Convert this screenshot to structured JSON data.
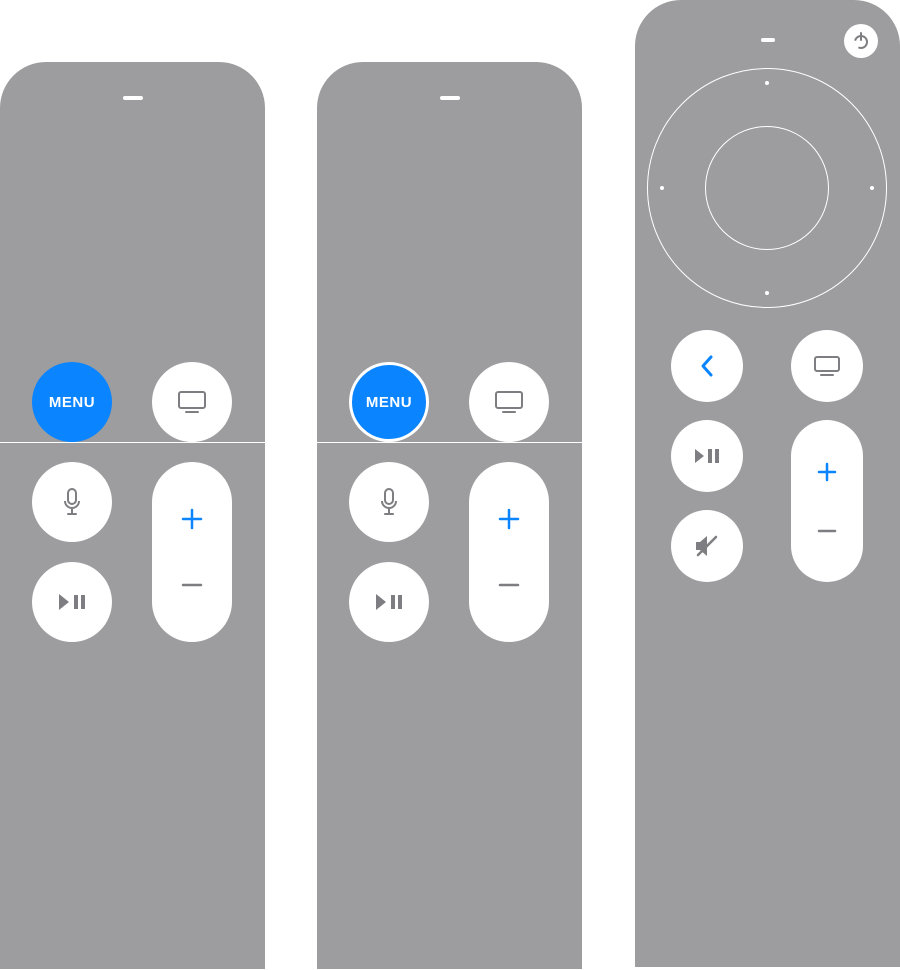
{
  "colors": {
    "remote_body": "#9d9da0",
    "button_bg": "#ffffff",
    "accent_blue": "#0a84ff",
    "icon_gray": "#7e7e82"
  },
  "remotes": [
    {
      "id": "siri-remote-1st-gen",
      "has_touch_surface": true,
      "buttons": {
        "menu": {
          "label": "MENU",
          "highlighted": true,
          "ring": false
        },
        "tv": {
          "icon": "tv-icon"
        },
        "mic": {
          "icon": "mic-icon"
        },
        "play_pause": {
          "icon": "play-pause-icon"
        },
        "volume": {
          "up_icon": "plus-icon",
          "down_icon": "minus-icon"
        }
      }
    },
    {
      "id": "siri-remote-1st-gen-alt",
      "has_touch_surface": true,
      "buttons": {
        "menu": {
          "label": "MENU",
          "highlighted": true,
          "ring": true
        },
        "tv": {
          "icon": "tv-icon"
        },
        "mic": {
          "icon": "mic-icon"
        },
        "play_pause": {
          "icon": "play-pause-icon"
        },
        "volume": {
          "up_icon": "plus-icon",
          "down_icon": "minus-icon"
        }
      }
    },
    {
      "id": "siri-remote-2nd-gen",
      "has_click_wheel": true,
      "has_side_button": true,
      "buttons": {
        "power": {
          "icon": "power-icon"
        },
        "back": {
          "icon": "chevron-left-icon",
          "color": "accent"
        },
        "tv": {
          "icon": "tv-icon"
        },
        "play_pause": {
          "icon": "play-pause-icon"
        },
        "mute": {
          "icon": "mute-icon"
        },
        "volume": {
          "up_icon": "plus-icon",
          "down_icon": "minus-icon"
        }
      }
    }
  ]
}
